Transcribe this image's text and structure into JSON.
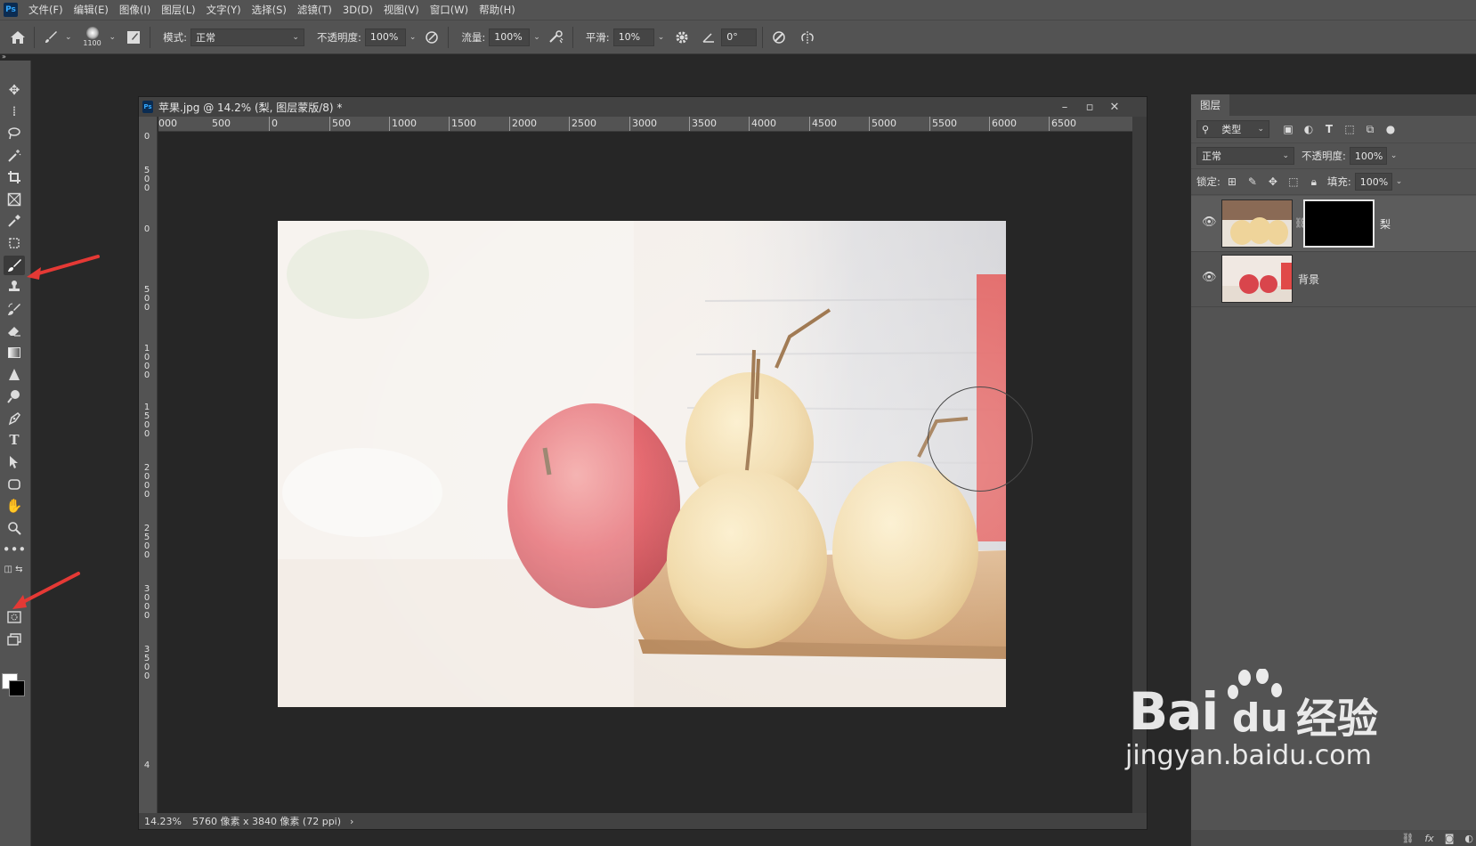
{
  "app": {
    "logo": "Ps"
  },
  "menu": [
    "文件(F)",
    "编辑(E)",
    "图像(I)",
    "图层(L)",
    "文字(Y)",
    "选择(S)",
    "滤镜(T)",
    "3D(D)",
    "视图(V)",
    "窗口(W)",
    "帮助(H)"
  ],
  "options": {
    "brush_size": "1100",
    "mode_label": "模式:",
    "mode_value": "正常",
    "opacity_label": "不透明度:",
    "opacity_value": "100%",
    "flow_label": "流量:",
    "flow_value": "100%",
    "smooth_label": "平滑:",
    "smooth_value": "10%",
    "angle_value": "0°"
  },
  "tools": [
    "move-icon",
    "marquee-icon",
    "lasso-icon",
    "magic-wand-icon",
    "crop-icon",
    "frame-icon",
    "eyedropper-icon",
    "patch-icon",
    "brush-icon",
    "stamp-icon",
    "history-brush-icon",
    "eraser-icon",
    "gradient-icon",
    "blur-icon",
    "dodge-icon",
    "pen-icon",
    "type-icon",
    "path-select-icon",
    "shape-icon",
    "hand-icon",
    "zoom-icon",
    "more-icon"
  ],
  "colors": {
    "foreground": "#ffffff",
    "background": "#000000",
    "annotation_arrow": "#e53935"
  },
  "document": {
    "title": "苹果.jpg @ 14.2% (梨, 图层蒙版/8) *",
    "zoom": "14.23%",
    "info": "5760 像素 x 3840 像素 (72 ppi)",
    "ruler_h": [
      "000",
      "500",
      "0",
      "500",
      "1000",
      "1500",
      "2000",
      "2500",
      "3000",
      "3500",
      "4000",
      "4500",
      "5000",
      "5500",
      "6000",
      "6500"
    ],
    "ruler_v": [
      "0",
      "500",
      "0",
      "500",
      "1000",
      "1500",
      "2000",
      "2500",
      "3000",
      "3500",
      "4"
    ]
  },
  "layers_panel": {
    "tab": "图层",
    "filter_value": "类型",
    "blend_mode": "正常",
    "opacity_label": "不透明度:",
    "opacity_value": "100%",
    "lock_label": "锁定:",
    "fill_label": "填充:",
    "fill_value": "100%",
    "layers": [
      {
        "name": "梨",
        "has_mask": true,
        "visible": true,
        "selected": true
      },
      {
        "name": "背景",
        "has_mask": false,
        "visible": true,
        "selected": false
      }
    ]
  },
  "watermark": {
    "brand": "Bai",
    "brand2": "du",
    "cn": "经验",
    "url": "jingyan.baidu.com"
  }
}
